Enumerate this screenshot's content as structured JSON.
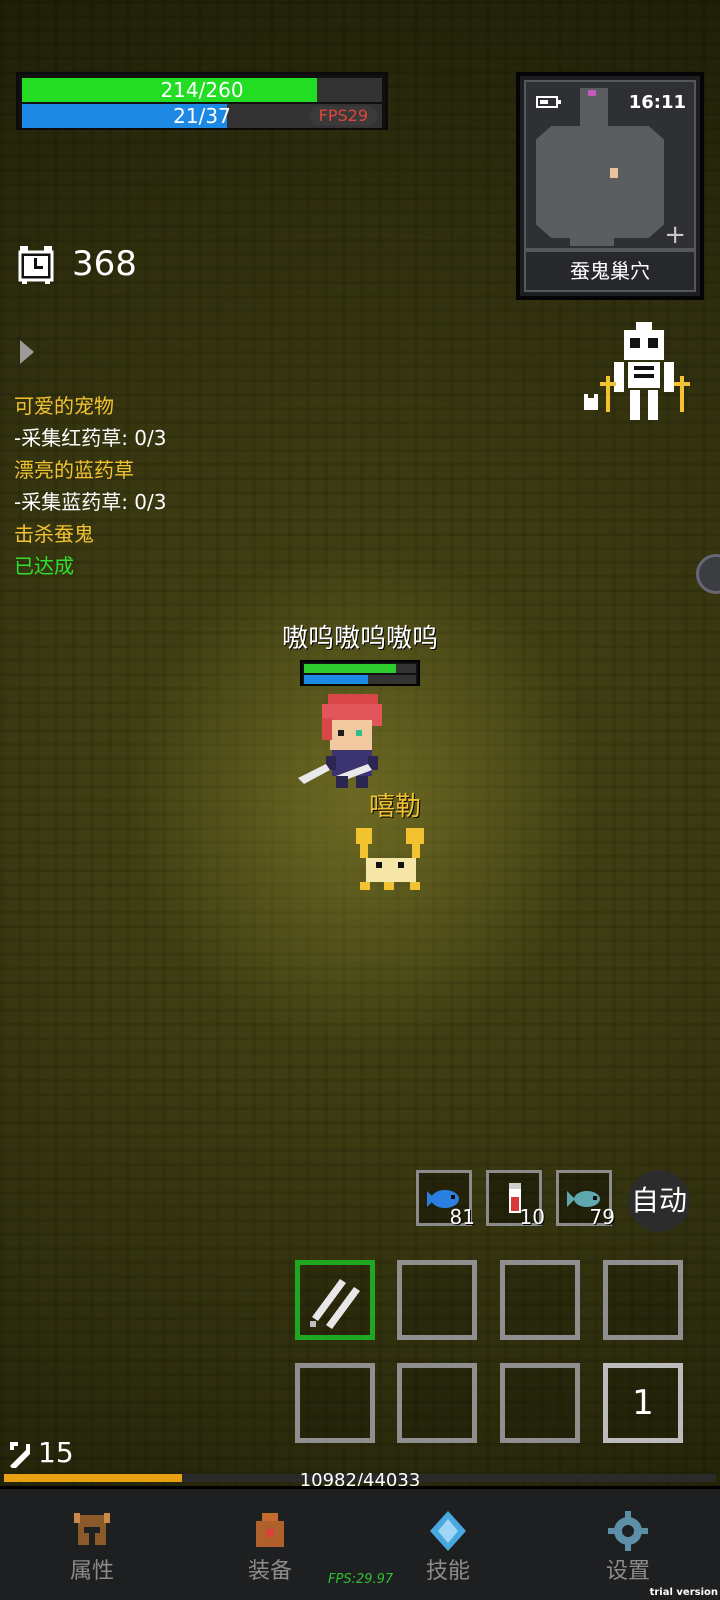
{
  "status": {
    "hp_text": "214/260",
    "hp_fraction": 0.82,
    "mp_text": "21/37",
    "mp_fraction": 0.57,
    "fps_badge": "FPS29"
  },
  "minimap": {
    "time": "16:11",
    "location": "蚕鬼巢穴",
    "expand_icon": "plus-icon"
  },
  "timer": {
    "value": "368",
    "icon": "alarm-clock-icon"
  },
  "quests": [
    {
      "title": "可爱的宠物",
      "objective": "-采集红药草: 0/3"
    },
    {
      "title": "漂亮的蓝药草",
      "objective": "-采集蓝药草: 0/3"
    },
    {
      "title": "击杀蚕鬼",
      "status": "已达成"
    }
  ],
  "player": {
    "name": "嗷呜嗷呜嗷呜",
    "hp_fraction": 0.82,
    "mp_fraction": 0.57
  },
  "pet": {
    "name": "嘻勒"
  },
  "consumables": [
    {
      "icon": "blue-fish-icon",
      "count": "81"
    },
    {
      "icon": "red-potion-icon",
      "count": "10"
    },
    {
      "icon": "teal-fish-icon",
      "count": "79"
    }
  ],
  "auto_button": "自动",
  "skill_page": "1",
  "level": {
    "icon": "sword-level-icon",
    "value": "15"
  },
  "experience": {
    "text": "10982/44033",
    "fraction": 0.25
  },
  "nav": [
    {
      "icon": "helmet-icon",
      "label": "属性"
    },
    {
      "icon": "bag-icon",
      "label": "装备"
    },
    {
      "icon": "crystal-icon",
      "label": "技能"
    },
    {
      "icon": "gear-icon",
      "label": "设置"
    }
  ],
  "bottom_fps": "FPS:29.97",
  "watermark": "trial version"
}
